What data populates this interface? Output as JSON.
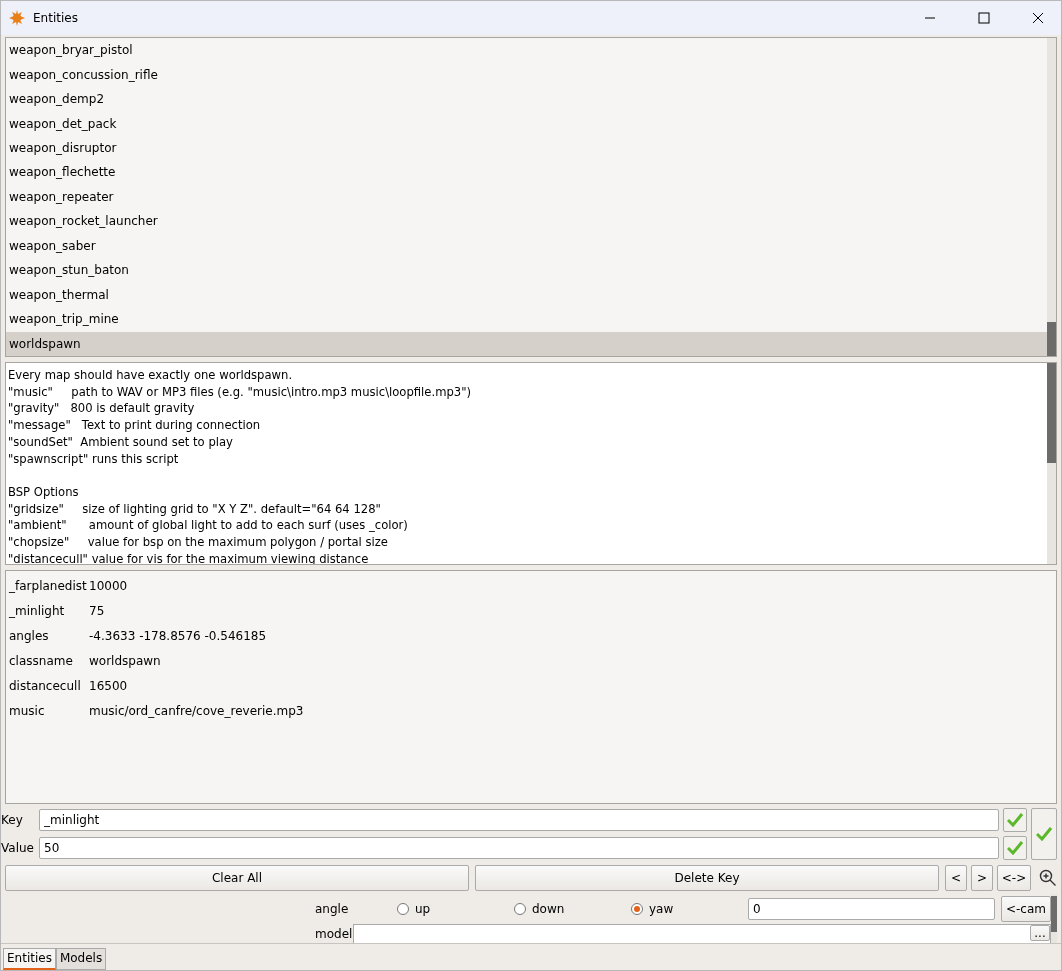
{
  "window": {
    "title": "Entities"
  },
  "entity_list": [
    {
      "label": "weapon_bryar_pistol",
      "selected": false
    },
    {
      "label": "weapon_concussion_rifle",
      "selected": false
    },
    {
      "label": "weapon_demp2",
      "selected": false
    },
    {
      "label": "weapon_det_pack",
      "selected": false
    },
    {
      "label": "weapon_disruptor",
      "selected": false
    },
    {
      "label": "weapon_flechette",
      "selected": false
    },
    {
      "label": "weapon_repeater",
      "selected": false
    },
    {
      "label": "weapon_rocket_launcher",
      "selected": false
    },
    {
      "label": "weapon_saber",
      "selected": false
    },
    {
      "label": "weapon_stun_baton",
      "selected": false
    },
    {
      "label": "weapon_thermal",
      "selected": false
    },
    {
      "label": "weapon_trip_mine",
      "selected": false
    },
    {
      "label": "worldspawn",
      "selected": true
    }
  ],
  "description": [
    [
      "Every map should have exactly one worldspawn.",
      "\"music\"     path to WAV or MP3 files (e.g. \"music\\intro.mp3 music\\loopfile.mp3\")",
      "\"gravity\"   800 is default gravity",
      "\"message\"   Text to print during connection",
      "\"soundSet\"  Ambient sound set to play",
      "\"spawnscript\" runs this script"
    ],
    [
      "BSP Options",
      "\"gridsize\"     size of lighting grid to \"X Y Z\". default=\"64 64 128\"",
      "\"ambient\"      amount of global light to add to each surf (uses _color)",
      "\"chopsize\"     value for bsp on the maximum polygon / portal size",
      "\"distancecull\" value for vis for the maximum viewing distance"
    ]
  ],
  "properties": [
    {
      "key": "_farplanedist",
      "value": "10000"
    },
    {
      "key": "_minlight",
      "value": "75"
    },
    {
      "key": "angles",
      "value": "-4.3633 -178.8576 -0.546185"
    },
    {
      "key": "classname",
      "value": "worldspawn"
    },
    {
      "key": "distancecull",
      "value": "16500"
    },
    {
      "key": "music",
      "value": "music/ord_canfre/cove_reverie.mp3"
    }
  ],
  "key_field": {
    "label": "Key",
    "value": "_minlight"
  },
  "value_field": {
    "label": "Value",
    "value": "50"
  },
  "buttons": [
    "Clear All",
    "Delete Key",
    "<",
    ">",
    "<->"
  ],
  "angle": {
    "label": "angle",
    "options": [
      {
        "label": "up",
        "selected": false
      },
      {
        "label": "down",
        "selected": false
      },
      {
        "label": "yaw",
        "selected": true
      }
    ],
    "value": "0",
    "button": "<-cam"
  },
  "model": {
    "label": "model",
    "button": "..."
  },
  "tabs": [
    {
      "label": "Entities",
      "selected": true
    },
    {
      "label": "Models",
      "selected": false
    }
  ]
}
